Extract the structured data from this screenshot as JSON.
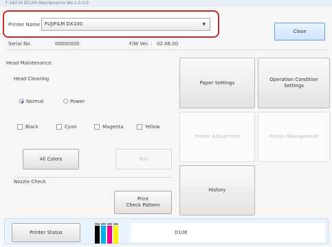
{
  "window": {
    "title": "F-183 M-D5100 Maintenance Ver.1.0.0.0"
  },
  "header": {
    "printer_name_label": "Printer Name",
    "printer_name_value": "FUJIFILM DX100",
    "close_label": "Close",
    "serial_label": "Serial No.",
    "serial_value": "00000000",
    "fw_label": "F/W Ver. :",
    "fw_value": "02.06.00"
  },
  "head_maintenance": {
    "section_title": "Head Maintenance",
    "head_cleaning_label": "Head Cleaning",
    "modes": [
      {
        "label": "Normal",
        "selected": true
      },
      {
        "label": "Power",
        "selected": false
      }
    ],
    "colors": [
      {
        "label": "Black",
        "checked": false
      },
      {
        "label": "Cyan",
        "checked": false
      },
      {
        "label": "Magenta",
        "checked": false
      },
      {
        "label": "Yellow",
        "checked": false
      }
    ],
    "all_colors_label": "All Colors",
    "run_label": "Run"
  },
  "nozzle_check": {
    "section_title": "Nozzle Check",
    "print_button_label": "Print\nCheck Pattern"
  },
  "tiles": {
    "paper_settings": "Paper Settings",
    "operation_condition_settings": "Operation Condition\nSettings",
    "printer_adjustment": "Printer Adjustment",
    "printer_management": "Printer Management",
    "history": "History"
  },
  "status": {
    "printer_status_label": "Printer Status",
    "ink_colors": [
      "#ffffff",
      "#00aeef",
      "#ec008c",
      "#fff200"
    ],
    "status_text": "D10K"
  },
  "accent_colors": {
    "highlight": "#d0262b"
  }
}
